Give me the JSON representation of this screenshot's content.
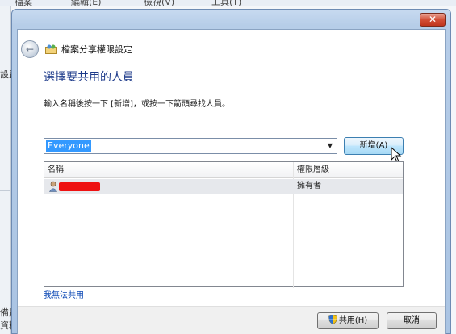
{
  "background": {
    "menu_items": [
      "檔案",
      "編輯(E)",
      "檢視(V)",
      "工具(T)"
    ],
    "left_texts": [
      "設置",
      "備覽",
      "資料"
    ]
  },
  "dialog": {
    "close_label": "✕",
    "back_icon": "back-arrow-icon",
    "title": "檔案分享權限設定",
    "heading": "選擇要共用的人員",
    "instruction": "輸入名稱後按一下 [新增]，或按一下箭頭尋找人員。",
    "combo": {
      "value": "Everyone"
    },
    "add_button": "新增(A)",
    "list": {
      "columns": [
        "名稱",
        "權限層級"
      ],
      "rows": [
        {
          "name": "",
          "name_redacted": true,
          "permission": "擁有者"
        }
      ]
    },
    "help_link": "我無法共用",
    "share_button": "共用(H)",
    "cancel_button": "取消"
  },
  "colors": {
    "heading": "#1c3a8a",
    "link": "#0a47b5",
    "selection": "#3399ff",
    "redaction": "#ee1111",
    "frame": "#aac4e3"
  }
}
